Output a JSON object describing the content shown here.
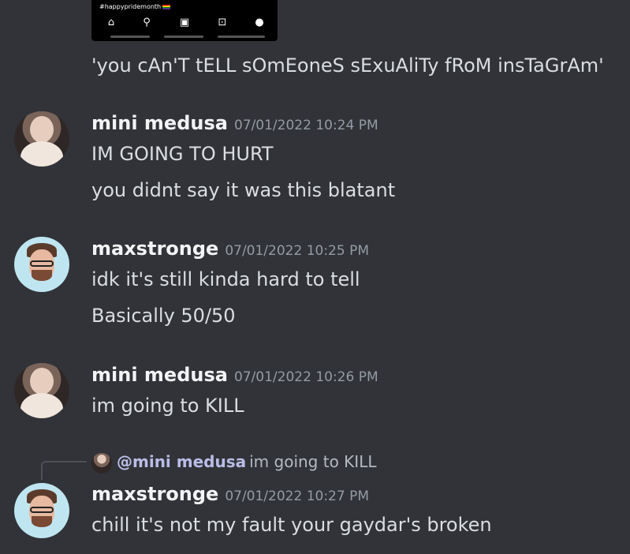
{
  "embed": {
    "hashtag": "#happypridemonth",
    "nav_icons": [
      "home-icon",
      "search-icon",
      "reels-icon",
      "shop-icon",
      "profile-icon"
    ]
  },
  "intro_message": {
    "text": "'you cAn'T tELL sOmEoneS sExuAliTy fRoM insTaGrAm'"
  },
  "messages": [
    {
      "author": "mini medusa",
      "timestamp": "07/01/2022 10:24 PM",
      "lines": [
        "IM GOING TO HURT",
        "you didnt say it was this blatant"
      ]
    },
    {
      "author": "maxstronge",
      "timestamp": "07/01/2022 10:25 PM",
      "lines": [
        "idk it's still kinda hard to tell",
        "Basically 50/50"
      ]
    },
    {
      "author": "mini medusa",
      "timestamp": "07/01/2022 10:26 PM",
      "lines": [
        "im going to KILL"
      ]
    },
    {
      "reply_to": {
        "mention": "@mini medusa",
        "text": "im going to KILL"
      },
      "author": "maxstronge",
      "timestamp": "07/01/2022 10:27 PM",
      "lines": [
        "chill it's not my fault your gaydar's broken"
      ]
    }
  ],
  "colors": {
    "background": "#313338",
    "text": "#dbdee1",
    "username": "#f2f3f5",
    "timestamp": "#949ba4"
  }
}
